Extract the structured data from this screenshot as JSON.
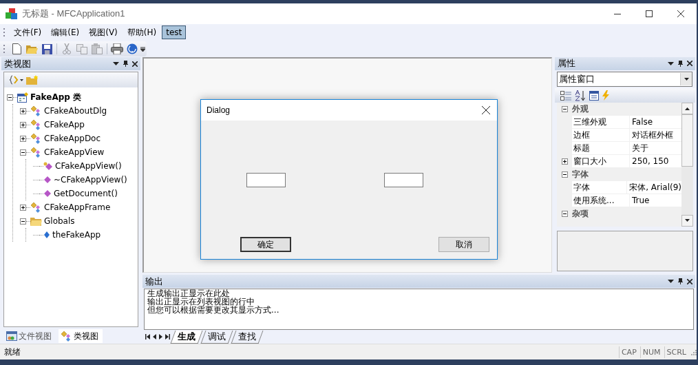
{
  "window": {
    "title": "无标题 - MFCApplication1"
  },
  "menu": [
    {
      "label": "文件(F)",
      "selected": false
    },
    {
      "label": "编辑(E)",
      "selected": false
    },
    {
      "label": "视图(V)",
      "selected": false
    },
    {
      "label": "帮助(H)",
      "selected": false
    },
    {
      "label": "test",
      "selected": true
    }
  ],
  "toolbar": [
    {
      "kind": "new",
      "disabled": false
    },
    {
      "kind": "open",
      "disabled": false
    },
    {
      "kind": "save",
      "disabled": false
    },
    {
      "kind": "cut",
      "disabled": true
    },
    {
      "kind": "copy",
      "disabled": true
    },
    {
      "kind": "paste",
      "disabled": true
    },
    {
      "kind": "print",
      "disabled": false
    },
    {
      "kind": "help",
      "disabled": false
    }
  ],
  "class_view": {
    "title": "类视图",
    "tree": [
      {
        "label": "FakeApp 类",
        "kind": "project",
        "expanded": true,
        "children": [
          {
            "label": "CFakeAboutDlg",
            "kind": "class",
            "expanded": false
          },
          {
            "label": "CFakeApp",
            "kind": "class",
            "expanded": false
          },
          {
            "label": "CFakeAppDoc",
            "kind": "class",
            "expanded": false
          },
          {
            "label": "CFakeAppView",
            "kind": "class",
            "expanded": true,
            "children": [
              {
                "label": "CFakeAppView()",
                "kind": "protected_method"
              },
              {
                "label": "~CFakeAppView()",
                "kind": "method"
              },
              {
                "label": "GetDocument()",
                "kind": "method"
              }
            ]
          },
          {
            "label": "CFakeAppFrame",
            "kind": "class",
            "expanded": false
          },
          {
            "label": "Globals",
            "kind": "folder",
            "expanded": true,
            "children": [
              {
                "label": "theFakeApp",
                "kind": "variable"
              }
            ]
          }
        ]
      }
    ],
    "tabs": [
      {
        "label": "文件视图",
        "kind": "files",
        "selected": false
      },
      {
        "label": "类视图",
        "kind": "classes",
        "selected": true
      }
    ]
  },
  "dialog": {
    "title": "Dialog",
    "fields": [
      {
        "kind": "edit"
      },
      {
        "kind": "edit"
      }
    ],
    "buttons": [
      {
        "label": "确定",
        "default": true
      },
      {
        "label": "取消",
        "default": false
      }
    ]
  },
  "properties": {
    "title": "属性",
    "object": "属性窗口",
    "groups": [
      {
        "label": "外观",
        "expanded": true,
        "rows": [
          {
            "name": "三维外观",
            "value": "False",
            "kind": "plain"
          },
          {
            "name": "边框",
            "value": "对话框外框",
            "kind": "plain"
          },
          {
            "name": "标题",
            "value": "关于",
            "kind": "plain"
          },
          {
            "name": "窗口大小",
            "value": "250, 150",
            "kind": "compound"
          }
        ]
      },
      {
        "label": "字体",
        "expanded": true,
        "rows": [
          {
            "name": "字体",
            "value": "宋体, Arial(9)",
            "kind": "plain"
          },
          {
            "name": "使用系统...",
            "value": "True",
            "kind": "plain"
          }
        ]
      },
      {
        "label": "杂项",
        "expanded": true
      }
    ]
  },
  "output": {
    "title": "输出",
    "lines": [
      "生成输出正显示在此处",
      "输出正显示在列表视图的行中",
      "但您可以根据需要更改其显示方式..."
    ],
    "tabs": [
      {
        "label": "生成",
        "selected": true
      },
      {
        "label": "调试",
        "selected": false
      },
      {
        "label": "查找",
        "selected": false
      }
    ]
  },
  "status_bar": {
    "text": "就绪",
    "indicators": [
      "CAP",
      "NUM",
      "SCRL"
    ]
  }
}
